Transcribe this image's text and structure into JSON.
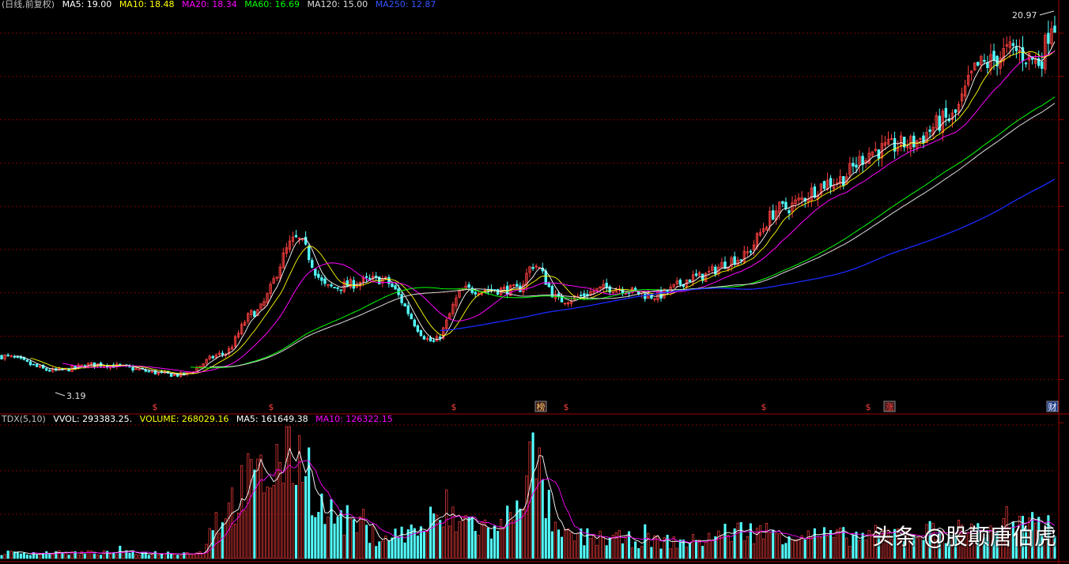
{
  "header": {
    "title": "(日线,前复权)",
    "ma5": "MA5: 19.00",
    "ma10": "MA10: 18.48",
    "ma20": "MA20: 18.34",
    "ma60": "MA60: 16.69",
    "ma120": "MA120: 15.00",
    "ma250": "MA250: 12.87"
  },
  "volume_header": {
    "indicator": "TDX(5,10)",
    "vvol": "VVOL: 293383.25.",
    "volume": "VOLUME: 268029.16",
    "ma5": "MA5: 161649.38",
    "ma10": "MA10: 126322.15"
  },
  "annotations": {
    "high": "20.97",
    "low": "3.19"
  },
  "markers": [
    "$",
    "$",
    "$",
    "榜",
    "$",
    "$",
    "$",
    "涨",
    "财"
  ],
  "watermark": "头条 @股颠唐伯虎",
  "colors": {
    "ma5": "#ffffff",
    "ma10": "#ffff00",
    "ma20": "#ff00ff",
    "ma60": "#00ff00",
    "ma120": "#dddddd",
    "ma250": "#0000ff",
    "up": "#ff4040",
    "down": "#54ffff",
    "grid": "#7a0000"
  },
  "chart_data": {
    "type": "candlestick",
    "title": "(日线,前复权)",
    "ylim": [
      3.19,
      20.97
    ],
    "key_points": [
      {
        "t": 0.0,
        "price": 4.6
      },
      {
        "t": 0.05,
        "price": 3.9
      },
      {
        "t": 0.09,
        "price": 4.2
      },
      {
        "t": 0.17,
        "price": 3.7
      },
      {
        "t": 0.21,
        "price": 4.7
      },
      {
        "t": 0.24,
        "price": 6.7
      },
      {
        "t": 0.28,
        "price": 10.2
      },
      {
        "t": 0.31,
        "price": 7.9
      },
      {
        "t": 0.36,
        "price": 8.3
      },
      {
        "t": 0.41,
        "price": 5.3
      },
      {
        "t": 0.44,
        "price": 7.8
      },
      {
        "t": 0.49,
        "price": 7.8
      },
      {
        "t": 0.505,
        "price": 9.0
      },
      {
        "t": 0.53,
        "price": 7.3
      },
      {
        "t": 0.58,
        "price": 7.9
      },
      {
        "t": 0.62,
        "price": 7.5
      },
      {
        "t": 0.66,
        "price": 8.4
      },
      {
        "t": 0.7,
        "price": 9.3
      },
      {
        "t": 0.74,
        "price": 11.7
      },
      {
        "t": 0.79,
        "price": 13.0
      },
      {
        "t": 0.83,
        "price": 14.5
      },
      {
        "t": 0.86,
        "price": 14.8
      },
      {
        "t": 0.9,
        "price": 16.0
      },
      {
        "t": 0.93,
        "price": 18.6
      },
      {
        "t": 0.96,
        "price": 19.3
      },
      {
        "t": 0.985,
        "price": 18.8
      },
      {
        "t": 1.0,
        "price": 20.97
      }
    ],
    "volume_shape": [
      {
        "t": 0.0,
        "v": 0.05
      },
      {
        "t": 0.19,
        "v": 0.05
      },
      {
        "t": 0.2,
        "v": 0.35
      },
      {
        "t": 0.24,
        "v": 0.7
      },
      {
        "t": 0.28,
        "v": 1.0
      },
      {
        "t": 0.31,
        "v": 0.4
      },
      {
        "t": 0.36,
        "v": 0.2
      },
      {
        "t": 0.44,
        "v": 0.35
      },
      {
        "t": 0.47,
        "v": 0.25
      },
      {
        "t": 0.505,
        "v": 0.85
      },
      {
        "t": 0.53,
        "v": 0.2
      },
      {
        "t": 0.65,
        "v": 0.15
      },
      {
        "t": 0.7,
        "v": 0.25
      },
      {
        "t": 0.8,
        "v": 0.2
      },
      {
        "t": 0.9,
        "v": 0.25
      },
      {
        "t": 1.0,
        "v": 0.3
      }
    ]
  }
}
